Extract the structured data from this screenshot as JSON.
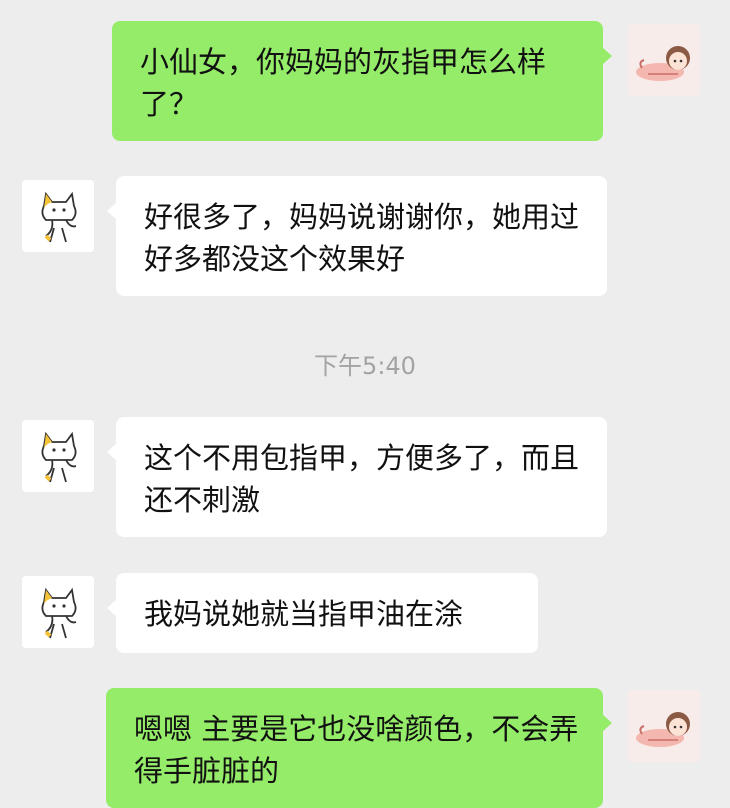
{
  "messages": [
    {
      "sender": "me",
      "text": "小仙女，你妈妈的灰指甲怎么样了？"
    },
    {
      "sender": "them",
      "text": "好很多了，妈妈说谢谢你，她用过好多都没这个效果好"
    },
    {
      "sender": "them",
      "text": "这个不用包指甲，方便多了，而且还不刺激"
    },
    {
      "sender": "them",
      "text": "我妈说她就当指甲油在涂"
    },
    {
      "sender": "me",
      "text": "嗯嗯 主要是它也没啥颜色，不会弄得手脏脏的"
    }
  ],
  "timestamp": "下午5:40",
  "colors": {
    "background": "#ededed",
    "my_bubble": "#95ec69",
    "their_bubble": "#ffffff",
    "timestamp_text": "#a3a3a3"
  },
  "icons": {
    "my_avatar": "girl-lying-avatar-icon",
    "their_avatar": "cat-sticker-avatar-icon"
  }
}
